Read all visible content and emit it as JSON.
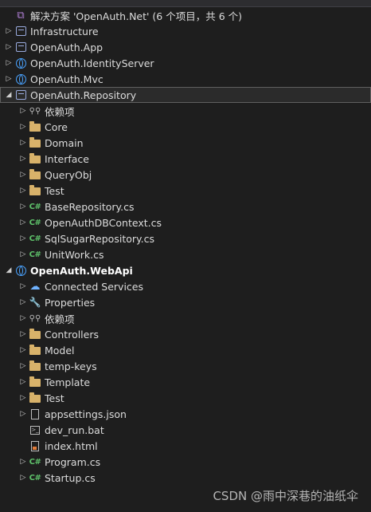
{
  "solution": {
    "label": "解决方案 'OpenAuth.Net' (6 个项目，共 6 个)"
  },
  "projects_collapsed": [
    {
      "label": "Infrastructure"
    },
    {
      "label": "OpenAuth.App"
    },
    {
      "label": "OpenAuth.IdentityServer"
    },
    {
      "label": "OpenAuth.Mvc"
    }
  ],
  "repository": {
    "label": "OpenAuth.Repository",
    "items": [
      "依赖项",
      "Core",
      "Domain",
      "Interface",
      "QueryObj",
      "Test",
      "BaseRepository.cs",
      "OpenAuthDBContext.cs",
      "SqlSugarRepository.cs",
      "UnitWork.cs"
    ]
  },
  "webapi": {
    "label": "OpenAuth.WebApi",
    "items": [
      "Connected Services",
      "Properties",
      "依赖项",
      "Controllers",
      "Model",
      "temp-keys",
      "Template",
      "Test",
      "appsettings.json",
      "dev_run.bat",
      "index.html",
      "Program.cs",
      "Startup.cs"
    ]
  },
  "icons": {
    "expanded": "chevron-down-icon",
    "collapsed": "chevron-right-icon",
    "folder": "folder-icon",
    "csharp": "csharp-file-icon",
    "project": "project-icon",
    "web_project": "web-project-icon",
    "dependencies": "dependencies-icon"
  },
  "watermark": "CSDN @雨中深巷的油纸伞"
}
